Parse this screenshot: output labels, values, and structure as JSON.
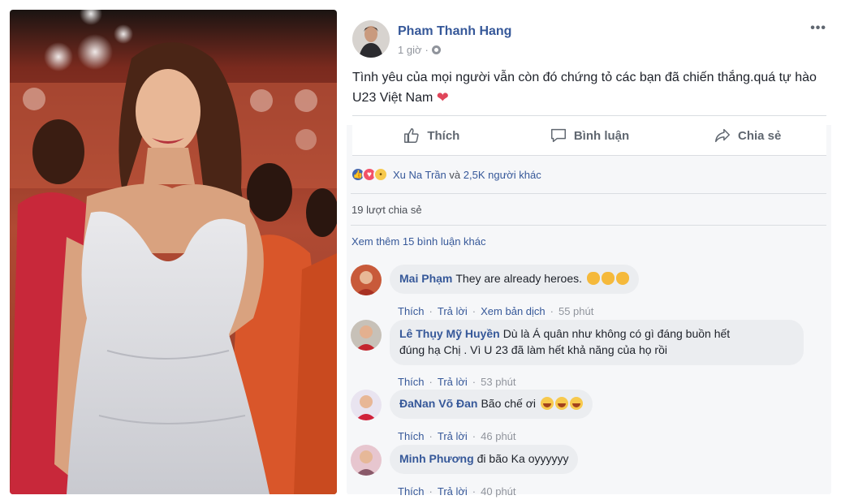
{
  "post": {
    "author": "Pham Thanh Hang",
    "time": "1 giờ",
    "more_label": "•••",
    "text": "Tình yêu của mọi người vẫn còn đó chứng tỏ các bạn đã chiến thắng.quá tự hào U23 Việt Nam",
    "actions": {
      "like": "Thích",
      "comment": "Bình luận",
      "share": "Chia sẻ"
    },
    "reactions": {
      "names": "Xu Na Trần",
      "connector": "và",
      "others": "2,5K người khác",
      "icons": [
        "like-icon",
        "love-icon",
        "sad-icon"
      ]
    },
    "shares": "19 lượt chia sẻ",
    "view_more": "Xem thêm 15 bình luận khác"
  },
  "comments": [
    {
      "name": "Mai Phạm",
      "text": "They are already heroes.",
      "like": "Thích",
      "reply": "Trả lời",
      "translate": "Xem bản dịch",
      "time": "55 phút"
    },
    {
      "name": "Lê Thụy Mỹ Huyền",
      "text": "Dù là Á quân như không có gì đáng buồn hết",
      "text2": "đúng hạ Chị . Vì U 23 đã làm hết khả năng của họ rồi",
      "like": "Thích",
      "reply": "Trả lời",
      "time": "53 phút"
    },
    {
      "name": "ĐaNan Võ Đan",
      "text": "Bão chế ơi",
      "like": "Thích",
      "reply": "Trả lời",
      "time": "46 phút"
    },
    {
      "name": "Minh Phương",
      "text": "đi bão Ka oyyyyyy",
      "like": "Thích",
      "reply": "Trả lời",
      "time": "40 phút"
    }
  ],
  "colors": {
    "link": "#365899",
    "muted": "#90949c",
    "bubble": "#ebedf0",
    "panel": "#f6f7f9"
  }
}
